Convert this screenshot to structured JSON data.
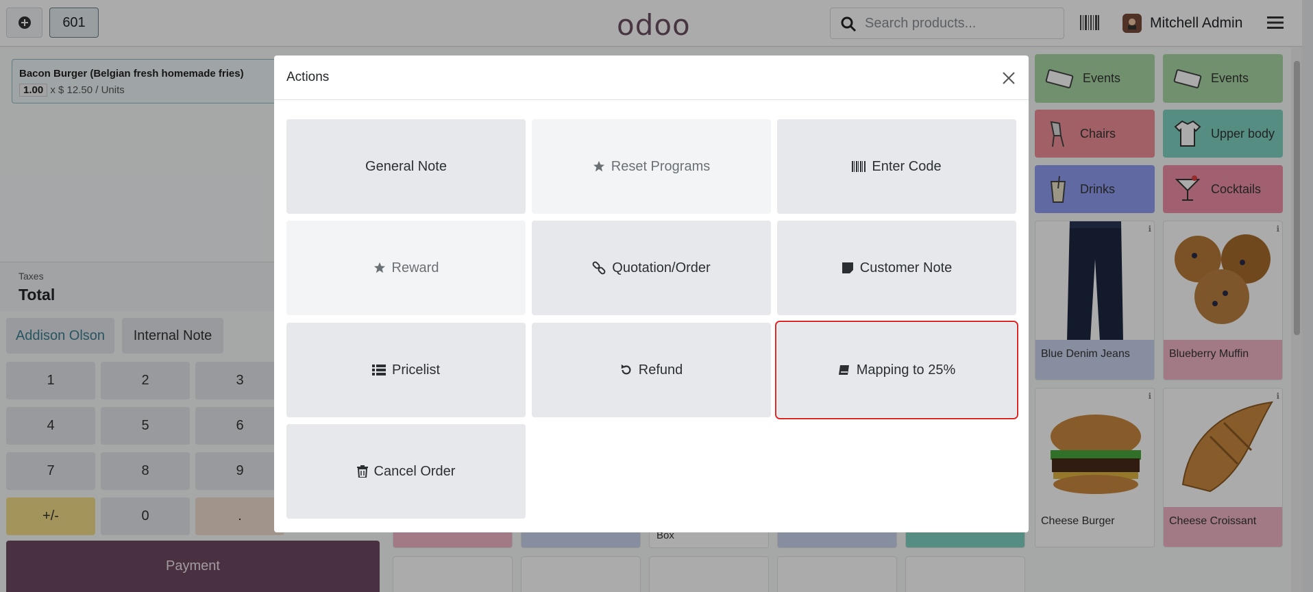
{
  "topbar": {
    "new_order_icon": "plus-circle-icon",
    "order_number": "601",
    "logo": "odoo",
    "search_placeholder": "Search products...",
    "barcode_icon": "barcode-icon",
    "user_name": "Mitchell Admin",
    "menu_icon": "hamburger-icon"
  },
  "order": {
    "line_name": "Bacon Burger (Belgian fresh homemade fries)",
    "line_qty": "1.00",
    "line_price": "x $ 12.50 / Units",
    "taxes_label": "Taxes",
    "total_label": "Total"
  },
  "controls": {
    "customer": "Addison Olson",
    "internal_note": "Internal Note",
    "keys": [
      "1",
      "2",
      "3",
      "4",
      "5",
      "6",
      "7",
      "8",
      "9",
      "+/-",
      "0",
      "."
    ],
    "payment": "Payment"
  },
  "categories": [
    {
      "label": "Events",
      "color": "#a9d9a4",
      "icon": "ticket-icon"
    },
    {
      "label": "Events",
      "color": "#a9d9a4",
      "icon": "ticket-icon"
    },
    {
      "label": "Chairs",
      "color": "#ef8f97",
      "icon": "chair-icon"
    },
    {
      "label": "Upper body",
      "color": "#7fd3c4",
      "icon": "shirt-icon"
    },
    {
      "label": "Drinks",
      "color": "#8f9df0",
      "icon": "glass-icon"
    },
    {
      "label": "Cocktails",
      "color": "#ef8fa6",
      "icon": "cocktail-icon"
    }
  ],
  "products": [
    {
      "name": "Blue Denim Jeans",
      "color": "#c9d4ef"
    },
    {
      "name": "Blueberry Muffin",
      "color": "#f2b6c8"
    },
    {
      "name": "Cheese Burger",
      "color": "#ffffff"
    },
    {
      "name": "Cheese Croissant",
      "color": "#f2b6c8"
    }
  ],
  "partial_label": "Box",
  "modal": {
    "title": "Actions",
    "close_icon": "close-icon",
    "actions": [
      {
        "label": "General Note",
        "icon": "",
        "dim": false
      },
      {
        "label": "Reset Programs",
        "icon": "star-icon",
        "dim": true
      },
      {
        "label": "Enter Code",
        "icon": "barcode-icon",
        "dim": false
      },
      {
        "label": "Reward",
        "icon": "star-icon",
        "dim": true
      },
      {
        "label": "Quotation/Order",
        "icon": "link-icon",
        "dim": false
      },
      {
        "label": "Customer Note",
        "icon": "sticky-note-icon",
        "dim": false
      },
      {
        "label": "Pricelist",
        "icon": "list-icon",
        "dim": false
      },
      {
        "label": "Refund",
        "icon": "undo-icon",
        "dim": false
      },
      {
        "label": "Mapping to 25%",
        "icon": "book-icon",
        "dim": false,
        "highlighted": true
      },
      {
        "label": "Cancel Order",
        "icon": "trash-icon",
        "dim": false
      }
    ]
  },
  "colors": {
    "accent": "#6e4a63",
    "highlight": "#e02424"
  }
}
